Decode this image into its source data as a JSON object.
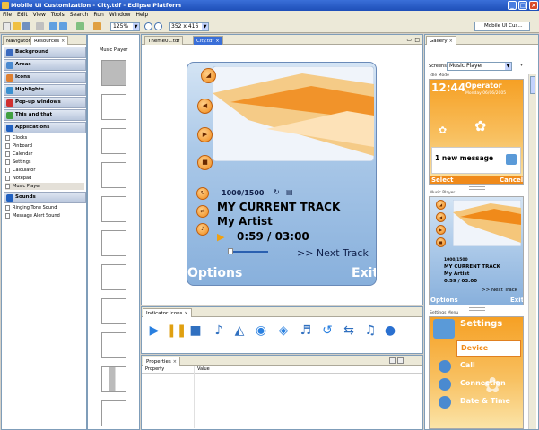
{
  "window": {
    "title": "Mobile UI Customization - City.tdf - Eclipse Platform"
  },
  "menu": [
    "File",
    "Edit",
    "View",
    "Tools",
    "Search",
    "Run",
    "Window",
    "Help"
  ],
  "toolbar": {
    "zoom": "125%",
    "resolution": "352 x 416",
    "perspective": "Mobile UI Cus..."
  },
  "left_panel": {
    "tabs": [
      "Navigator",
      "Resources"
    ],
    "categories": [
      {
        "label": "Background",
        "color": "#3a6ac0"
      },
      {
        "label": "Areas",
        "color": "#4a8ad0"
      },
      {
        "label": "Icons",
        "color": "#e08030"
      },
      {
        "label": "Highlights",
        "color": "#3a90d0"
      },
      {
        "label": "Pop-up windows",
        "color": "#d03030"
      },
      {
        "label": "This and that",
        "color": "#40a040"
      },
      {
        "label": "Applications",
        "color": "#2060c0"
      }
    ],
    "applications": [
      "Clocks",
      "Pinboard",
      "Calendar",
      "Settings",
      "Calculator",
      "Notepad",
      "Music Player"
    ],
    "selected_application": "Music Player",
    "sounds_label": "Sounds",
    "sounds": [
      "Ringing Tone Sound",
      "Message Alert Sound"
    ]
  },
  "thumbnails": {
    "header": "Music Player",
    "count": 11
  },
  "editor": {
    "tabs": [
      "Theme01.tdf",
      "City.tdf"
    ],
    "active_tab": "City.tdf",
    "player": {
      "counter": "1000/1500",
      "track": "MY CURRENT TRACK",
      "artist": "My Artist",
      "time": "0:59 / 03:00",
      "next": ">> Next Track",
      "left_softkey": "Options",
      "right_softkey": "Exit"
    }
  },
  "indicator": {
    "tab": "Indicator Icons",
    "icons": [
      "play-icon",
      "pause-icon",
      "stop-icon",
      "note-icon",
      "speaker-icon",
      "disc-icon",
      "box-icon",
      "audio-icon",
      "repeat-icon",
      "shuffle-icon",
      "music-note-icon",
      "globe-icon"
    ]
  },
  "properties": {
    "tab": "Properties",
    "col_property": "Property",
    "col_value": "Value"
  },
  "gallery": {
    "tab": "Gallery",
    "screens_label": "Screens:",
    "screens_value": "Music Player",
    "idle": {
      "section": "Idle Mode",
      "time": "12:44",
      "operator": "Operator",
      "date": "Monday 06/06/2005",
      "message": "1 new message",
      "left": "Select",
      "right": "Cancel"
    },
    "music": {
      "section": "Music Player",
      "counter": "1000/1500",
      "track": "MY CURRENT TRACK",
      "artist": "My Artist",
      "time": "0:59 / 03:00",
      "next": ">> Next Track",
      "left": "Options",
      "right": "Exit"
    },
    "settings": {
      "section": "Settings Menu",
      "title": "Settings",
      "items": [
        "Device",
        "Call",
        "Connection",
        "Date & Time"
      ]
    }
  }
}
